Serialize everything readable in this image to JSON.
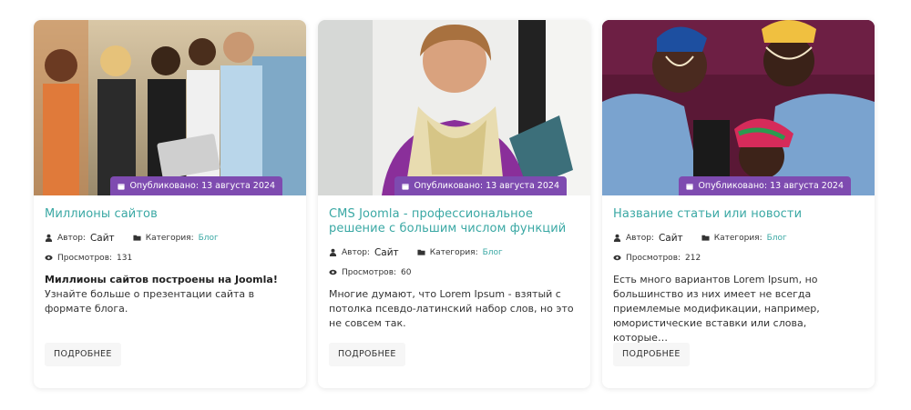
{
  "colors": {
    "accent": "#3aa8a4",
    "badge": "#7e4bb0"
  },
  "cards": [
    {
      "image_icon": "photo-friends-with-tablet",
      "published": "Опубликовано: 13 августа 2024",
      "title": "Миллионы сайтов",
      "author_label": "Автор:",
      "author": "Сайт",
      "category_label": "Категория:",
      "category": "Блог",
      "views_label": "Просмотров:",
      "views": "131",
      "excerpt_bold": "Миллионы сайтов построены на Joomla!",
      "excerpt": "Узнайте больше о презентации сайта в формате блога.",
      "more": "ПОДРОБНЕЕ"
    },
    {
      "image_icon": "photo-woman-with-scarf",
      "published": "Опубликовано: 13 августа 2024",
      "title": "CMS Joomla - профессиональное решение с большим числом функций",
      "author_label": "Автор:",
      "author": "Сайт",
      "category_label": "Категория:",
      "category": "Блог",
      "views_label": "Просмотров:",
      "views": "60",
      "excerpt_bold": "",
      "excerpt": "Многие думают, что Lorem Ipsum - взятый с потолка псевдо-латинский набор слов, но это не совсем так.",
      "more": "ПОДРОБНЕЕ"
    },
    {
      "image_icon": "photo-two-women-face-paint",
      "published": "Опубликовано: 13 августа 2024",
      "title": "Название статьи или новости",
      "author_label": "Автор:",
      "author": "Сайт",
      "category_label": "Категория:",
      "category": "Блог",
      "views_label": "Просмотров:",
      "views": "212",
      "excerpt_bold": "",
      "excerpt": "Есть много вариантов Lorem Ipsum, но большинство из них имеет не всегда приемлемые модификации, например, юмористические вставки или слова, которые…",
      "more": "ПОДРОБНЕЕ"
    }
  ]
}
